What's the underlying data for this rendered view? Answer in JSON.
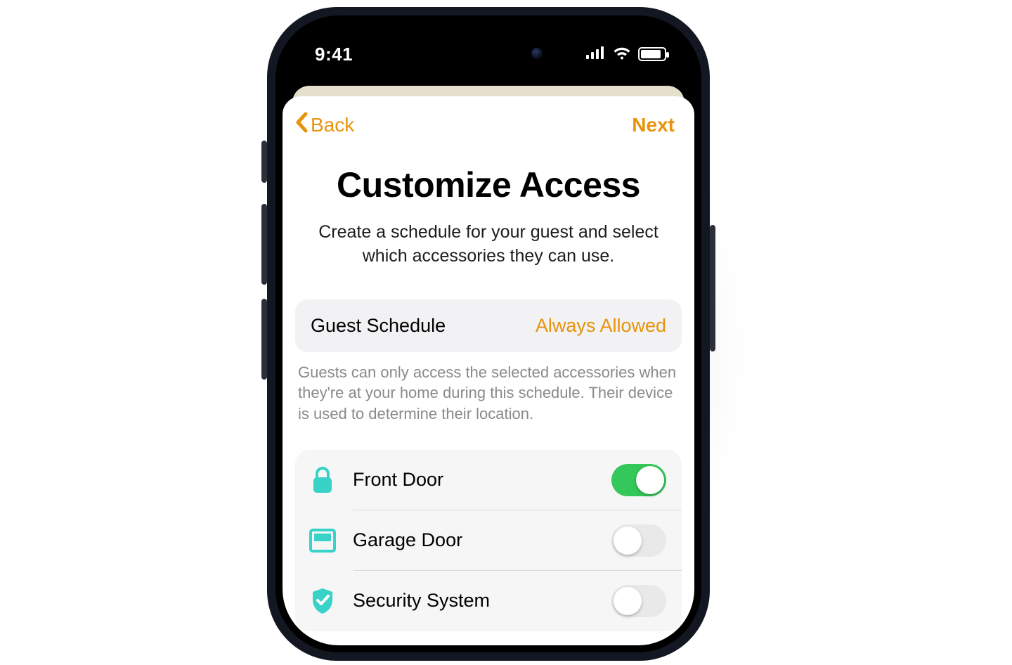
{
  "status": {
    "time": "9:41"
  },
  "nav": {
    "back_label": "Back",
    "next_label": "Next"
  },
  "hero": {
    "title": "Customize Access",
    "subtitle": "Create a schedule for your guest and select which accessories they can use."
  },
  "schedule": {
    "label": "Guest Schedule",
    "value": "Always Allowed",
    "footnote": "Guests can only access the selected accessories when they're at your home during this schedule. Their device is used to determine their location."
  },
  "accessories": [
    {
      "icon": "lock-icon",
      "label": "Front Door",
      "enabled": true
    },
    {
      "icon": "garage-icon",
      "label": "Garage Door",
      "enabled": false
    },
    {
      "icon": "shield-check-icon",
      "label": "Security System",
      "enabled": false
    }
  ],
  "colors": {
    "accent": "#e8930b",
    "switch_on": "#34c759",
    "teal": "#37d2c8"
  }
}
